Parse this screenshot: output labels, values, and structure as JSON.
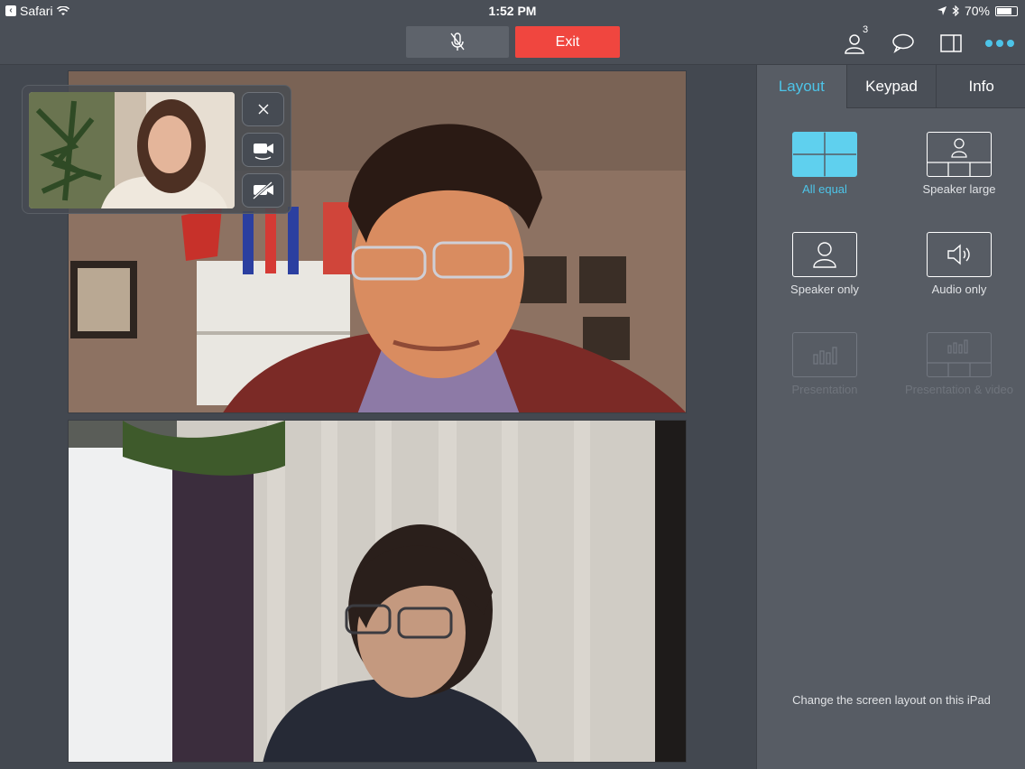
{
  "status_bar": {
    "app_name": "Safari",
    "time": "1:52 PM",
    "battery": "70%"
  },
  "toolbar": {
    "exit_label": "Exit",
    "participants_count": "3"
  },
  "panel": {
    "tabs": [
      {
        "label": "Layout"
      },
      {
        "label": "Keypad"
      },
      {
        "label": "Info"
      }
    ],
    "layouts": [
      {
        "label": "All equal"
      },
      {
        "label": "Speaker large"
      },
      {
        "label": "Speaker only"
      },
      {
        "label": "Audio only"
      },
      {
        "label": "Presentation"
      },
      {
        "label": "Presentation & video"
      }
    ],
    "hint": "Change the screen layout on this iPad"
  },
  "colors": {
    "accent": "#4dc4e8",
    "exit": "#f0463f",
    "background": "#464b53",
    "panel": "#575c64"
  }
}
